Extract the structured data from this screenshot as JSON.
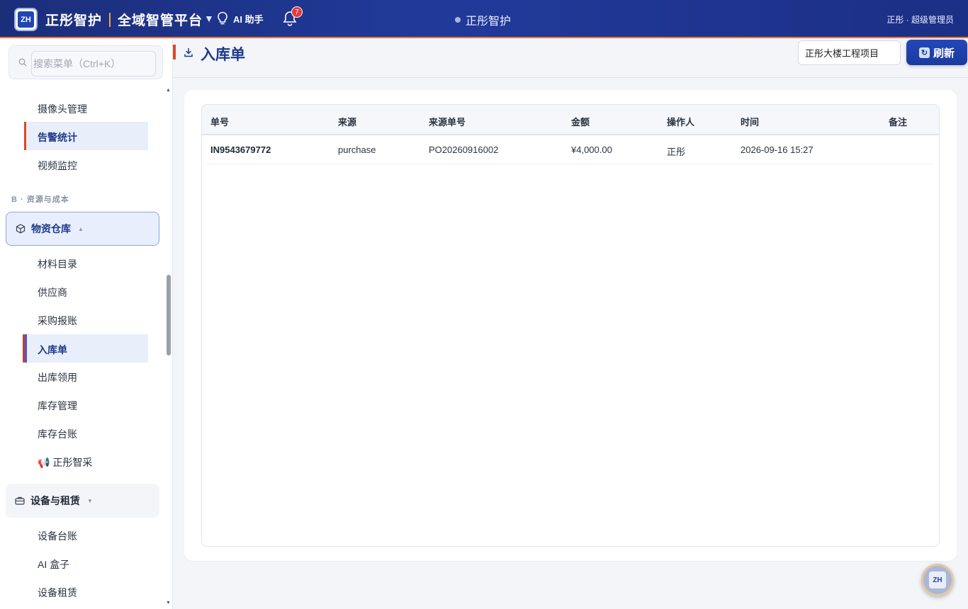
{
  "header": {
    "logo_text": "ZH",
    "brand_name": "正彤智护",
    "platform_name": "全域智管平台",
    "ai_label": "AI 助手",
    "bell_count": "7",
    "center_title": "正彤智护",
    "user_label": "正彤 · 超级管理员"
  },
  "sidebar": {
    "search_placeholder": "搜索菜单（Ctrl+K）",
    "items_top": [
      {
        "label": "摄像头管理"
      },
      {
        "label": "告警统计"
      },
      {
        "label": "视频监控"
      }
    ],
    "section_label": "B · 资源与成本",
    "group_materials": {
      "label": "物资仓库",
      "state": "expanded"
    },
    "materials_items": [
      {
        "label": "材料目录"
      },
      {
        "label": "供应商"
      },
      {
        "label": "采购报账"
      },
      {
        "label": "入库单"
      },
      {
        "label": "出库领用"
      },
      {
        "label": "库存管理"
      },
      {
        "label": "库存台账"
      },
      {
        "label": "📢 正彤智采"
      }
    ],
    "group_equipment": {
      "label": "设备与租赁",
      "state": "collapsed"
    },
    "equipment_items": [
      {
        "label": "设备台账"
      },
      {
        "label": "AI 盒子"
      },
      {
        "label": "设备租赁"
      }
    ]
  },
  "page": {
    "title": "入库单",
    "project_select_value": "正彤大楼工程项目",
    "refresh_label": "刷新"
  },
  "table": {
    "columns": [
      "单号",
      "来源",
      "来源单号",
      "金额",
      "操作人",
      "时间",
      "备注"
    ],
    "rows": [
      [
        "IN9543679772",
        "purchase",
        "PO20260916002",
        "¥4,000.00",
        "正彤",
        "2026-09-16 15:27",
        ""
      ]
    ]
  },
  "colors": {
    "header_bg": "#213a9a",
    "accent_orange": "#e8773a",
    "accent_red": "#d9482c",
    "primary_blue": "#1e3a8a"
  }
}
